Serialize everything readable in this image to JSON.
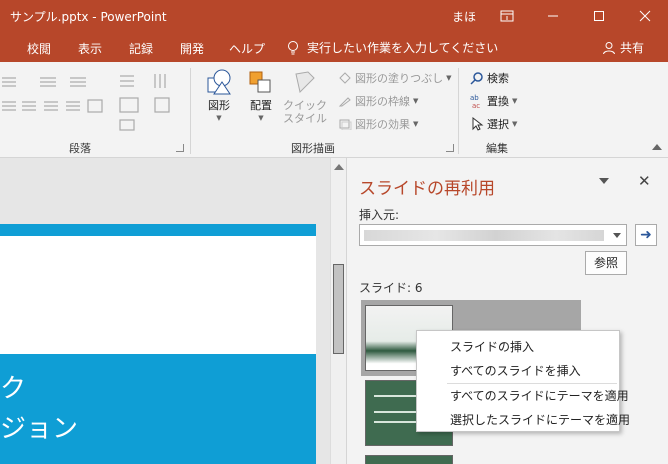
{
  "window": {
    "title": "サンプル.pptx  -  PowerPoint",
    "user": "まほ"
  },
  "menu": {
    "tabs": [
      "校閲",
      "表示",
      "記録",
      "開発",
      "ヘルプ"
    ],
    "tell_me": "実行したい作業を入力してください",
    "share": "共有"
  },
  "ribbon": {
    "paragraph": {
      "group_label": "段落"
    },
    "drawing": {
      "group_label": "図形描画",
      "shapes_label": "図形",
      "arrange_label": "配置",
      "quick_styles_label_1": "クイック",
      "quick_styles_label_2": "スタイル",
      "fill_label": "図形の塗りつぶし",
      "outline_label": "図形の枠線",
      "effects_label": "図形の効果"
    },
    "editing": {
      "group_label": "編集",
      "find_label": "検索",
      "replace_label": "置換",
      "select_label": "選択"
    }
  },
  "slide": {
    "line1": "ク",
    "line2": "ジョン"
  },
  "pane": {
    "title": "スライドの再利用",
    "insert_from_label": "挿入元:",
    "browse_label": "参照",
    "slides_count_label": "スライド: 6"
  },
  "context_menu": {
    "items": [
      "スライドの挿入",
      "すべてのスライドを挿入",
      "すべてのスライドにテーマを適用",
      "選択したスライドにテーマを適用"
    ]
  },
  "colors": {
    "accent": "#b7472a",
    "slide_blue": "#0f9ed5"
  }
}
